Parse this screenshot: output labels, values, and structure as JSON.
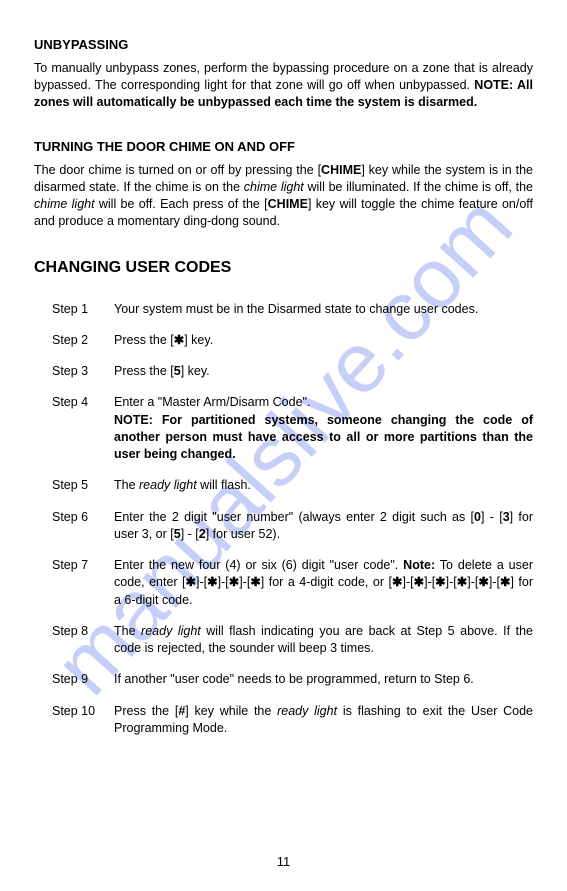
{
  "watermark": "manualslive.com",
  "unbypassing": {
    "heading": "UNBYPASSING",
    "p_a": "To manually unbypass zones, perform the bypassing procedure on a zone that is already bypassed. The corresponding light for that zone will go off when unbypassed. ",
    "p_note": "NOTE: All zones will automatically be unbypassed each time the system is disarmed."
  },
  "chime": {
    "heading": "TURNING THE DOOR CHIME ON AND OFF",
    "p_a": "The door chime is turned on or off by pressing the [",
    "p_b": "CHIME",
    "p_c": "] key while the system is in the disarmed state. If the chime is on the ",
    "p_d": "chime light",
    "p_e": " will be illuminated. If the chime is off, the ",
    "p_f": "chime light",
    "p_g": " will be off.  Each press of the [",
    "p_h": "CHIME",
    "p_i": "] key will toggle the chime feature on/off and produce a momentary ding-dong sound."
  },
  "codes": {
    "heading": "CHANGING USER CODES",
    "steps": [
      {
        "label": "Step 1",
        "body": {
          "a": "Your system must be in the Disarmed state to change user codes."
        }
      },
      {
        "label": "Step 2",
        "body": {
          "a": "Press the [",
          "b": "✱",
          "c": "] key."
        }
      },
      {
        "label": "Step 3",
        "body": {
          "a": "Press the [",
          "b": "5",
          "c": "] key."
        }
      },
      {
        "label": "Step 4",
        "body": {
          "a": "Enter a \"Master Arm/Disarm Code\".",
          "note": "NOTE: For partitioned systems, someone changing the code of another person must have access to all or more partitions than the user being changed."
        }
      },
      {
        "label": "Step 5",
        "body": {
          "a": "The ",
          "b": "ready light",
          "c": " will flash."
        }
      },
      {
        "label": "Step 6",
        "body": {
          "a": "Enter the 2 digit \"user number\" (always enter 2 digit such as [",
          "b": "0",
          "c": "] - [",
          "d": "3",
          "e": "] for user 3, or [",
          "f": "5",
          "g": "] - [",
          "h": "2",
          "i": "] for user 52)."
        }
      },
      {
        "label": "Step 7",
        "body": {
          "a": "Enter the new four (4) or six (6) digit \"user code\". ",
          "b": "Note:",
          "c": " To delete a user code, enter [",
          "d": "✱",
          "e": "]-[",
          "f": "✱",
          "g": "]-[",
          "h": "✱",
          "i": "]-[",
          "j": "✱",
          "k": "] for a 4-digit code, or [",
          "l": "✱",
          "m": "]-[",
          "n": "✱",
          "o": "]-[",
          "p": "✱",
          "q": "]-[",
          "r": "✱",
          "s": "]-[",
          "t": "✱",
          "u": "]-[",
          "v": "✱",
          "w": "] for a 6-digit code."
        }
      },
      {
        "label": "Step 8",
        "body": {
          "a": "The ",
          "b": "ready light",
          "c": " will flash indicating you are back at Step 5 above. If the code is rejected, the sounder will beep 3 times."
        }
      },
      {
        "label": "Step 9",
        "body": {
          "a": "If another \"user code\" needs to be programmed, return to Step 6."
        }
      },
      {
        "label": "Step 10",
        "body": {
          "a": "Press the [",
          "b": "#",
          "c": "] key while the ",
          "d": "ready light",
          "e": " is flashing to exit the User Code Programming Mode."
        }
      }
    ]
  },
  "pagenum": "11"
}
